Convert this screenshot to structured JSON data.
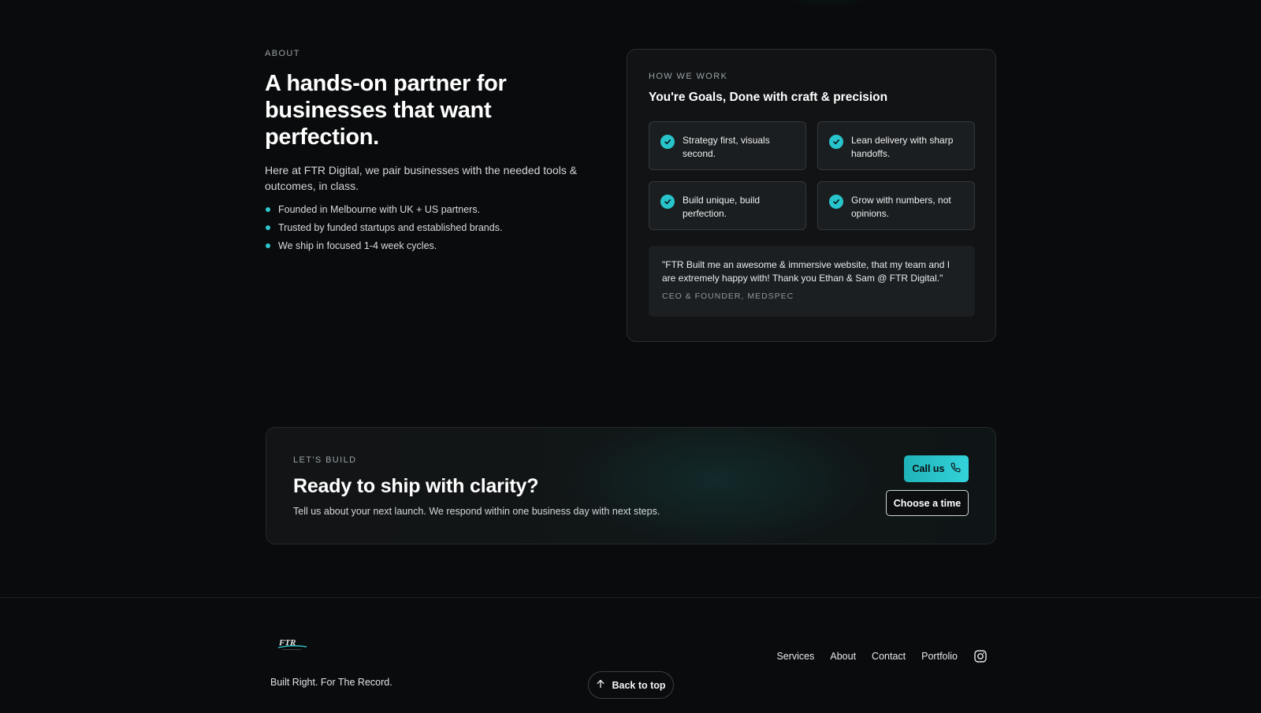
{
  "about": {
    "eyebrow": "ABOUT",
    "title_line1": "A hands-on partner for",
    "title_line2": "businesses that want perfection.",
    "text": "Here at FTR Digital, we pair businesses with the needed tools & outcomes, in class.",
    "bullets": [
      "Founded in Melbourne with UK + US partners.",
      "Trusted by funded startups and established brands.",
      "We ship in focused 1-4 week cycles."
    ]
  },
  "how_we_work": {
    "eyebrow": "HOW WE WORK",
    "title": "You're Goals, Done with craft & precision",
    "items": [
      "Strategy first, visuals second.",
      "Lean delivery with sharp handoffs.",
      "Build unique, build perfection.",
      "Grow with numbers, not opinions."
    ],
    "quote": "\"FTR Built me an awesome & immersive website, that my team and I are extremely happy with! Thank you Ethan & Sam @ FTR Digital.\"",
    "quote_author": "CEO & FOUNDER, MEDSPEC"
  },
  "cta": {
    "eyebrow": "LET'S BUILD",
    "title": "Ready to ship with clarity?",
    "text": "Tell us about your next launch. We respond within one business day with next steps.",
    "call_label": "Call us",
    "time_label": "Choose a time"
  },
  "footer": {
    "logo_text": "FTR",
    "tagline": "Built Right. For The Record.",
    "back_to_top": "Back to top",
    "nav": [
      "Services",
      "About",
      "Contact",
      "Portfolio"
    ],
    "social_icon": "instagram-icon"
  },
  "colors": {
    "accent": "#2ec9cf",
    "background": "#0a0b0c",
    "card": "#111314"
  }
}
